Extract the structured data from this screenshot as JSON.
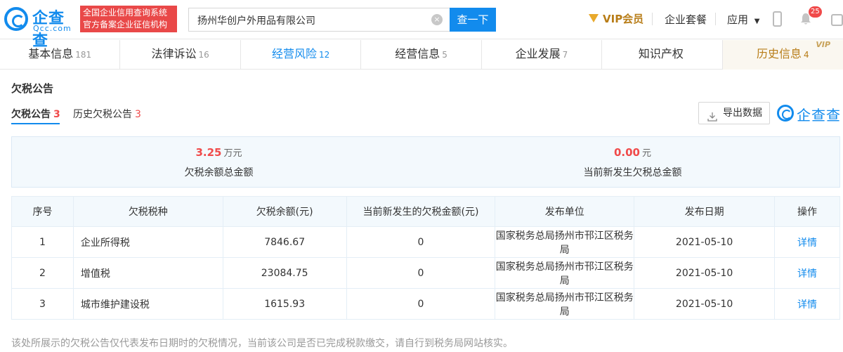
{
  "header": {
    "logo_text": "企查查",
    "logo_sub": "Qcc.com",
    "badge_line1": "全国企业信用查询系统",
    "badge_line2": "官方备案企业征信机构",
    "search_value": "扬州华创户外用品有限公司",
    "search_button": "查一下",
    "vip_label": "VIP会员",
    "suite_label": "企业套餐",
    "apps_label": "应用",
    "notify_count": "25"
  },
  "tabs": [
    {
      "label": "基本信息",
      "count": "181"
    },
    {
      "label": "法律诉讼",
      "count": "16"
    },
    {
      "label": "经营风险",
      "count": "12"
    },
    {
      "label": "经营信息",
      "count": "5"
    },
    {
      "label": "企业发展",
      "count": "7"
    },
    {
      "label": "知识产权",
      "count": ""
    },
    {
      "label": "历史信息",
      "count": "4",
      "tag": "VIP"
    }
  ],
  "section": {
    "title": "欠税公告",
    "subtabs": [
      {
        "label": "欠税公告",
        "count": "3"
      },
      {
        "label": "历史欠税公告",
        "count": "3"
      }
    ],
    "export_label": "导出数据",
    "brand_text": "企查查"
  },
  "summary": [
    {
      "value": "3.25",
      "unit": "万元",
      "label": "欠税余额总金额"
    },
    {
      "value": "0.00",
      "unit": "元",
      "label": "当前新发生欠税总金额"
    }
  ],
  "table": {
    "headers": [
      "序号",
      "欠税税种",
      "欠税余额(元)",
      "当前新发生的欠税金额(元)",
      "发布单位",
      "发布日期",
      "操作"
    ],
    "rows": [
      [
        "1",
        "企业所得税",
        "7846.67",
        "0",
        "国家税务总局扬州市邗江区税务局",
        "2021-05-10",
        "详情"
      ],
      [
        "2",
        "增值税",
        "23084.75",
        "0",
        "国家税务总局扬州市邗江区税务局",
        "2021-05-10",
        "详情"
      ],
      [
        "3",
        "城市维护建设税",
        "1615.93",
        "0",
        "国家税务总局扬州市邗江区税务局",
        "2021-05-10",
        "详情"
      ]
    ]
  },
  "footnote": "该处所展示的欠税公告仅代表发布日期时的欠税情况，当前该公司是否已完成税款缴交，请自行到税务局网站核实。",
  "colors": {
    "accent": "#128bed",
    "warn": "#f04a4a",
    "vip": "#b87d18"
  }
}
